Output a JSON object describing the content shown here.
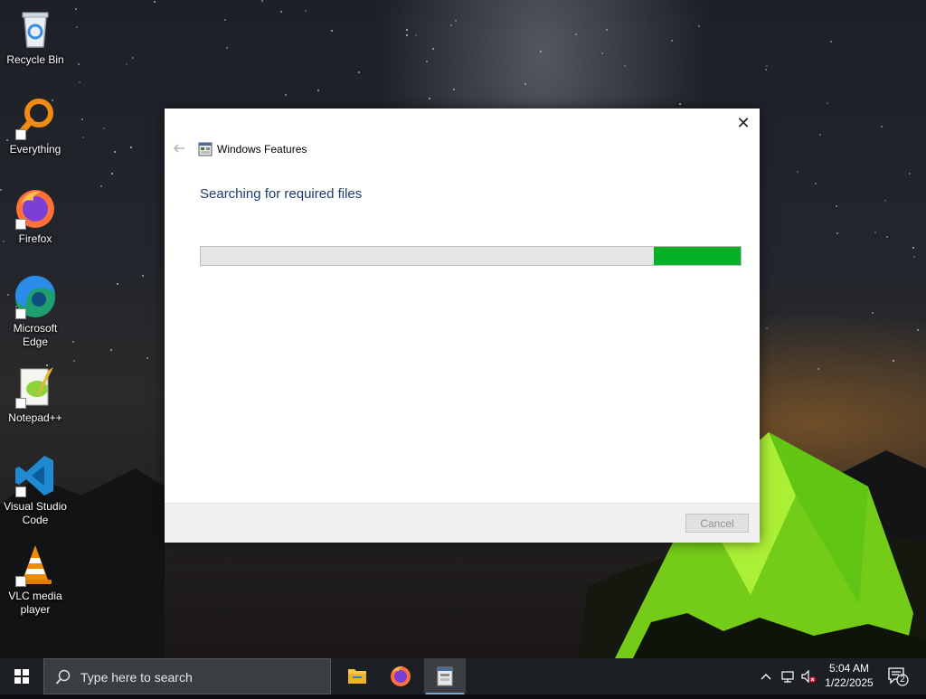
{
  "desktop": {
    "icons": [
      {
        "label": "Recycle Bin",
        "icon": "recycle-bin-icon"
      },
      {
        "label": "Everything",
        "icon": "everything-search-icon"
      },
      {
        "label": "Firefox",
        "icon": "firefox-icon"
      },
      {
        "label": "Microsoft Edge",
        "icon": "edge-icon"
      },
      {
        "label": "Notepad++",
        "icon": "notepadpp-icon"
      },
      {
        "label": "Visual Studio Code",
        "icon": "vscode-icon"
      },
      {
        "label": "VLC media player",
        "icon": "vlc-icon"
      }
    ]
  },
  "dialog": {
    "title": "Windows Features",
    "close_glyph": "✕",
    "heading": "Searching for required files",
    "progress": {
      "indeterminate": true,
      "segment_start": 0.84,
      "segment_end": 1.0,
      "color": "#06b025"
    },
    "cancel_label": "Cancel",
    "cancel_enabled": false
  },
  "taskbar": {
    "search_placeholder": "Type here to search",
    "apps": [
      {
        "name": "File Explorer",
        "icon": "folder-icon",
        "active": false
      },
      {
        "name": "Firefox",
        "icon": "firefox-icon",
        "active": false
      },
      {
        "name": "Windows Features",
        "icon": "windows-features-icon",
        "active": true
      }
    ],
    "tray": {
      "time": "5:04 AM",
      "date": "1/22/2025",
      "notification_count": "2"
    }
  },
  "colors": {
    "accent_heading": "#1e3a6e",
    "progress_green": "#06b025",
    "taskbar_bg": "#1c1f24"
  }
}
